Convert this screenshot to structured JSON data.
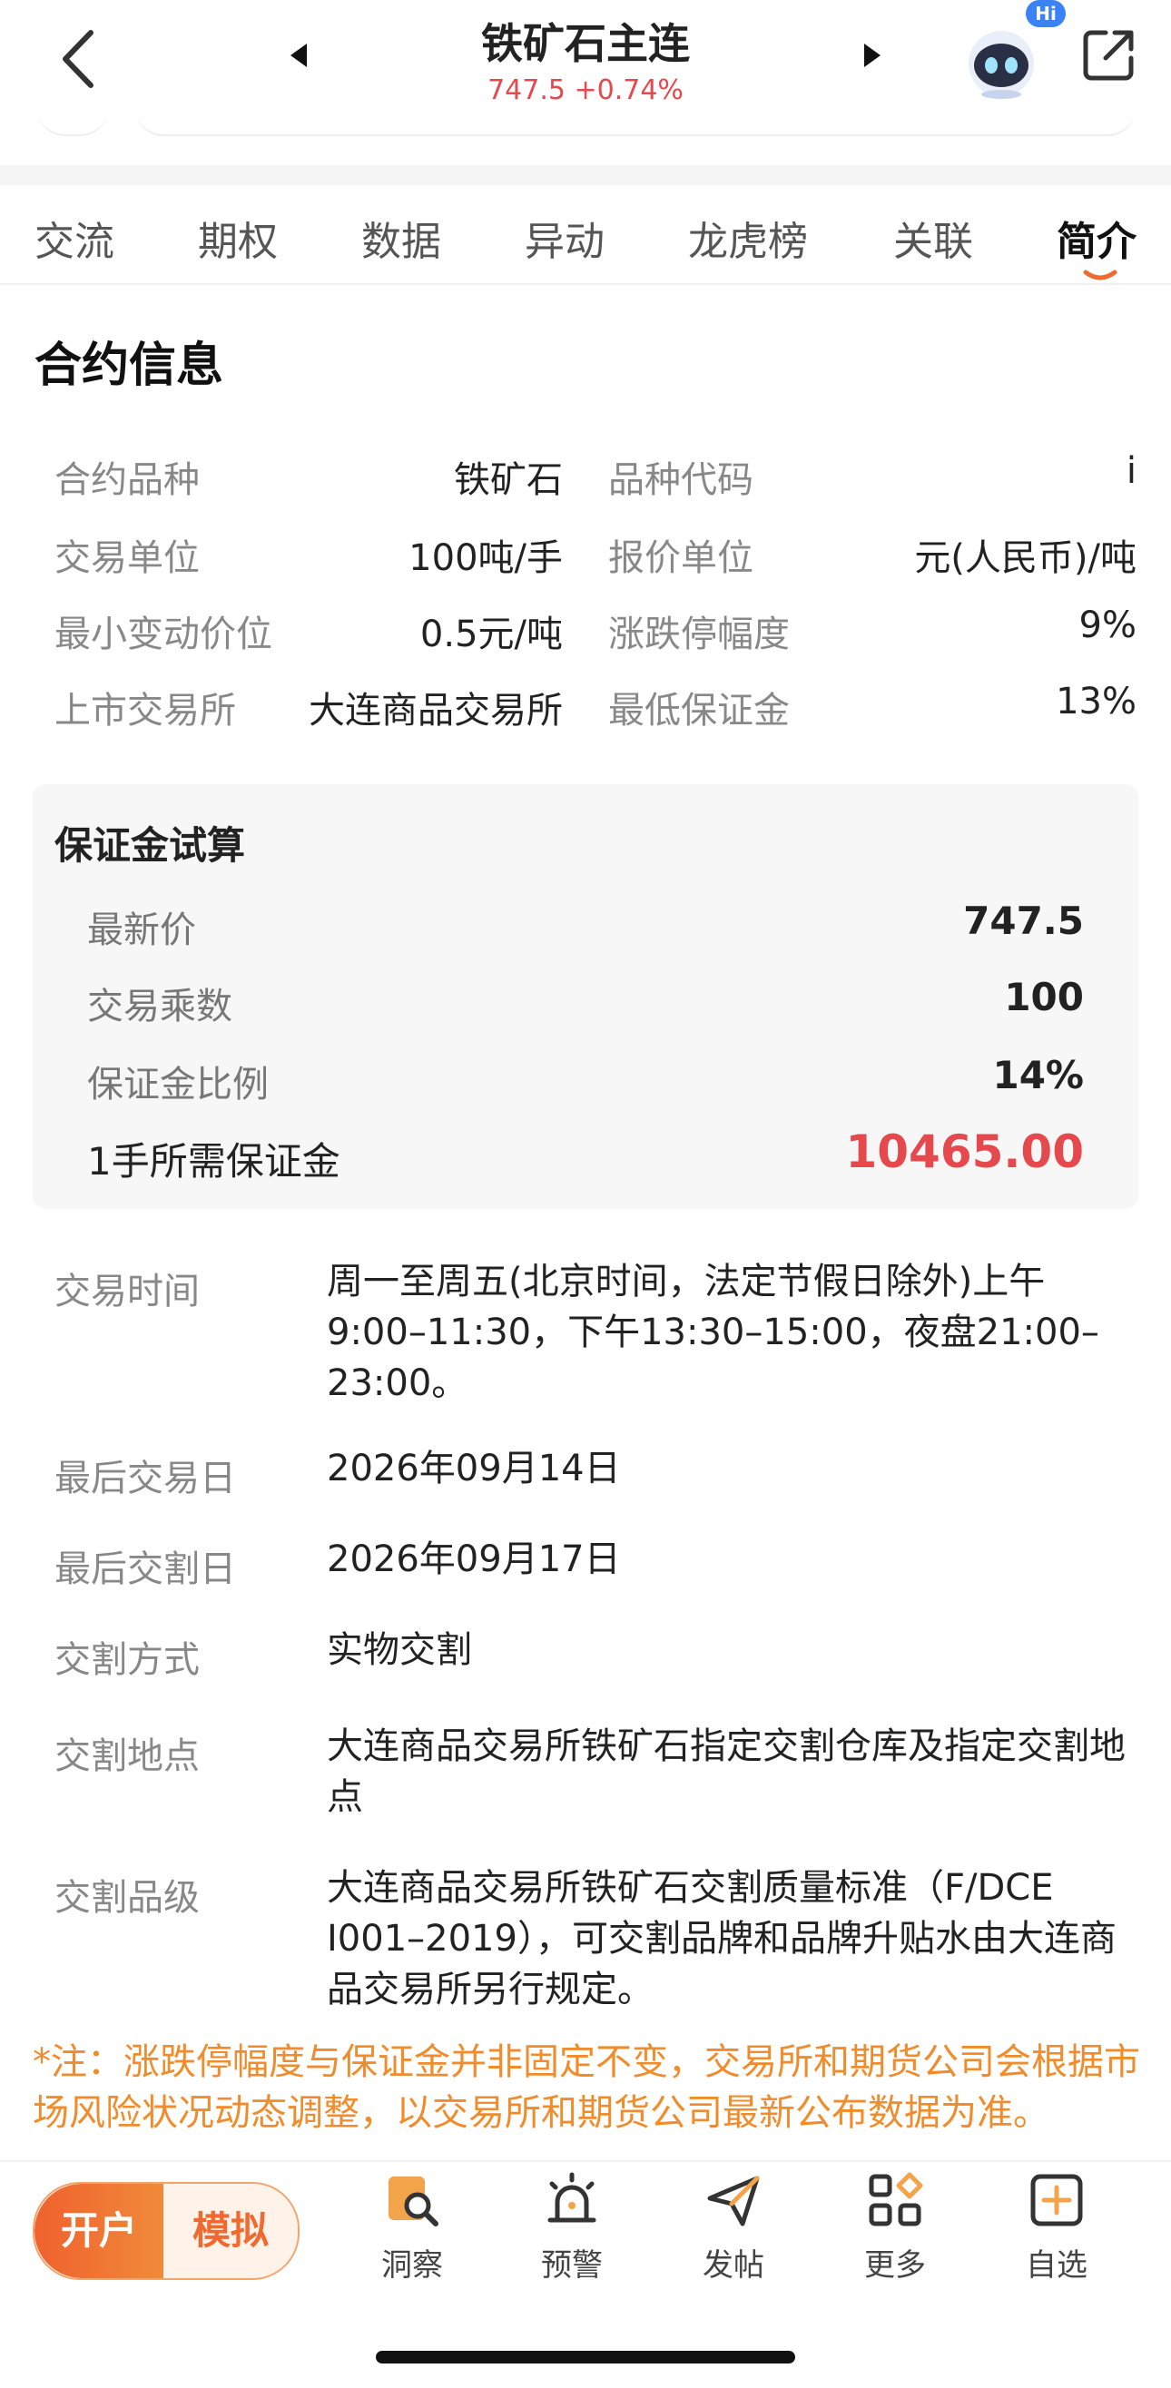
{
  "header": {
    "title": "铁矿石主连",
    "subtitle": "747.5 +0.74%",
    "badge": "Hi",
    "icons": {
      "back": "chevron-left-icon",
      "prev": "triangle-left-icon",
      "next": "triangle-right-icon",
      "assistant": "robot-icon",
      "share": "share-icon"
    }
  },
  "tabs": [
    {
      "label": "交流"
    },
    {
      "label": "期权"
    },
    {
      "label": "数据"
    },
    {
      "label": "异动"
    },
    {
      "label": "龙虎榜"
    },
    {
      "label": "关联"
    },
    {
      "label": "简介",
      "active": true
    }
  ],
  "contract": {
    "title": "合约信息",
    "rows": [
      {
        "l1": "合约品种",
        "v1": "铁矿石",
        "l2": "品种代码",
        "v2": "i"
      },
      {
        "l1": "交易单位",
        "v1": "100吨/手",
        "l2": "报价单位",
        "v2": "元(人民币)/吨"
      },
      {
        "l1": "最小变动价位",
        "v1": "0.5元/吨",
        "l2": "涨跌停幅度",
        "v2": "9%"
      },
      {
        "l1": "上市交易所",
        "v1": "大连商品交易所",
        "l2": "最低保证金",
        "v2": "13%"
      }
    ]
  },
  "margin_calc": {
    "title": "保证金试算",
    "rows": [
      {
        "label": "最新价",
        "value": "747.5"
      },
      {
        "label": "交易乘数",
        "value": "100"
      },
      {
        "label": "保证金比例",
        "value": "14%"
      }
    ],
    "total_label": "1手所需保证金",
    "total_value": "10465.00"
  },
  "details": [
    {
      "label": "交易时间",
      "value": "周一至周五(北京时间，法定节假日除外)上午9:00–11:30，下午13:30–15:00，夜盘21:00–23:00。"
    },
    {
      "label": "最后交易日",
      "value": "2026年09月14日"
    },
    {
      "label": "最后交割日",
      "value": "2026年09月17日"
    },
    {
      "label": "交割方式",
      "value": "实物交割"
    },
    {
      "label": "交割地点",
      "value": "大连商品交易所铁矿石指定交割仓库及指定交割地点"
    },
    {
      "label": "交割品级",
      "value": "大连商品交易所铁矿石交割质量标准（F/DCE I001–2019），可交割品牌和品牌升贴水由大连商品交易所另行规定。"
    }
  ],
  "note": "*注：涨跌停幅度与保证金并非固定不变，交易所和期货公司会根据市场风险状况动态调整，以交易所和期货公司最新公布数据为准。",
  "bottom": {
    "open_label": "开户",
    "sim_label": "模拟",
    "nav": [
      {
        "label": "洞察",
        "icon": "insight-icon"
      },
      {
        "label": "预警",
        "icon": "alarm-icon"
      },
      {
        "label": "发帖",
        "icon": "send-icon"
      },
      {
        "label": "更多",
        "icon": "more-grid-icon"
      },
      {
        "label": "自选",
        "icon": "add-watchlist-icon"
      }
    ]
  },
  "colors": {
    "accent": "#f06a2f",
    "price_up": "#e5484d",
    "note": "#f08c2b"
  }
}
